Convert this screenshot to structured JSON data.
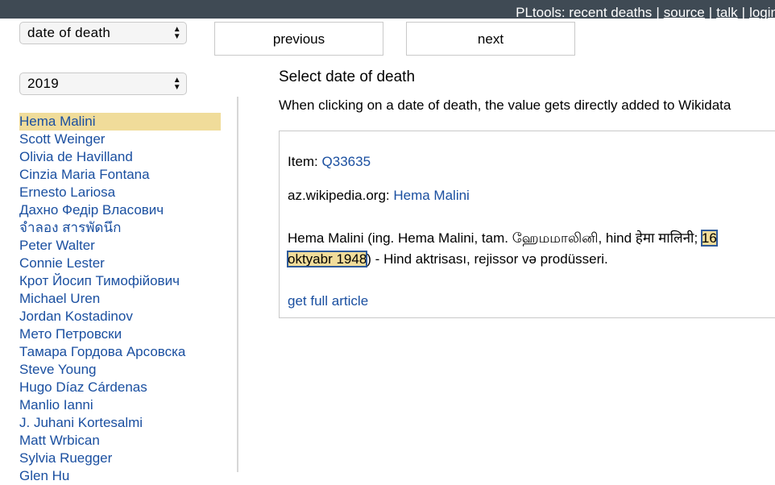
{
  "topbar": {
    "title": "PLtools: recent deaths",
    "links": [
      "source",
      "talk",
      "login"
    ]
  },
  "controls": {
    "sort_value": "date of death",
    "year_value": "2019",
    "previous_label": "previous",
    "next_label": "next"
  },
  "people": [
    "Hema Malini",
    "Scott Weinger",
    "Olivia de Havilland",
    "Cinzia Maria Fontana",
    "Ernesto Lariosa",
    "Дахно Федір Власович",
    "จำลอง สารพัดนึก",
    "Peter Walter",
    "Connie Lester",
    "Крот Йосип Тимофійович",
    "Michael Uren",
    "Jordan Kostadinov",
    "Мето Петровски",
    "Тамара Гордова Арсовска",
    "Steve Young",
    "Hugo Díaz Cárdenas",
    "Manlio Ianni",
    "J. Juhani Kortesalmi",
    "Matt Wrbican",
    "Sylvia Ruegger",
    "Glen Hu"
  ],
  "selected_index": 0,
  "main": {
    "heading": "Select date of death",
    "hint": "When clicking on a date of death, the value gets directly added to Wikidata",
    "item_label": "Item:",
    "item_id": "Q33635",
    "wiki_label": "az.wikipedia.org:",
    "wiki_title": "Hema Malini",
    "excerpt_before": "Hema Malini (ing. Hema Malini, tam. ஹேமமாலினி, hind हेमा मालिनी; ",
    "excerpt_date": "16 oktyabr 1948",
    "excerpt_after": ") - Hind aktrisası, rejissor və prodüsseri.",
    "full_article_label": "get full article"
  },
  "colors": {
    "topbar_bg": "#3f4a54",
    "link": "#1a4fa0",
    "highlight": "#f0dc9a"
  }
}
